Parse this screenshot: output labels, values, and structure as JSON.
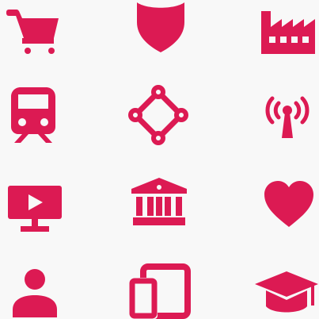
{
  "colors": {
    "accent": "#dc1a53",
    "background": "#f8f8f8"
  },
  "icons": [
    "shopping-cart-icon",
    "shield-icon",
    "factory-icon",
    "train-icon",
    "network-nodes-icon",
    "broadcast-tower-icon",
    "video-monitor-icon",
    "bank-icon",
    "heart-icon",
    "user-icon",
    "devices-icon",
    "graduation-cap-icon"
  ]
}
